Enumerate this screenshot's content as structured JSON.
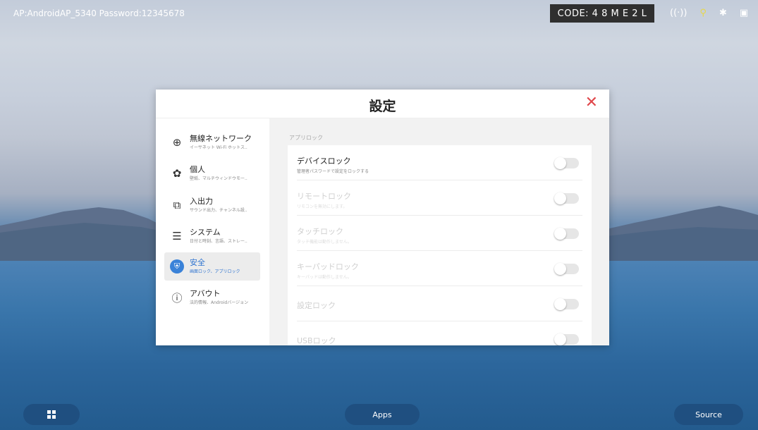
{
  "topbar": {
    "ap_info": "AP:AndroidAP_5340  Password:12345678",
    "code": "CODE: 4 8 M E 2 L",
    "icons": [
      "hotspot-icon",
      "usb-icon",
      "bluetooth-off-icon",
      "screen-icon"
    ]
  },
  "dialog": {
    "title": "設定",
    "close_symbol": "✕"
  },
  "sidebar": {
    "items": [
      {
        "title": "無線ネットワーク",
        "subtitle": "イーサネット Wi-Fi ホットス..",
        "icon": "globe-icon"
      },
      {
        "title": "個人",
        "subtitle": "壁紙、マルチウィンドウモー..",
        "icon": "palette-icon"
      },
      {
        "title": "入出力",
        "subtitle": "サウンド出力、チャンネル設..",
        "icon": "input-output-icon"
      },
      {
        "title": "システム",
        "subtitle": "日付と時刻、言語、ストレー..",
        "icon": "sliders-icon"
      },
      {
        "title": "安全",
        "subtitle": "画面ロック、アプリロック",
        "icon": "shield-icon",
        "active": true
      },
      {
        "title": "アバウト",
        "subtitle": "法的情報、Androidバージョン",
        "icon": "info-icon"
      }
    ]
  },
  "content": {
    "section_label": "アプリロック",
    "rows": [
      {
        "title": "デバイスロック",
        "subtitle": "管理者パスワードで設定をロックする",
        "enabled": true,
        "toggle_on": false
      },
      {
        "title": "リモートロック",
        "subtitle": "リモコンを無効にします。",
        "enabled": false,
        "toggle_on": false
      },
      {
        "title": "タッチロック",
        "subtitle": "タッチ機能は動作しません。",
        "enabled": false,
        "toggle_on": false
      },
      {
        "title": "キーパッドロック",
        "subtitle": "キーパッドは動作しません。",
        "enabled": false,
        "toggle_on": false
      },
      {
        "title": "設定ロック",
        "subtitle": "",
        "enabled": false,
        "toggle_on": false
      },
      {
        "title": "USBロック",
        "subtitle": "",
        "enabled": false,
        "toggle_on": false
      }
    ]
  },
  "taskbar": {
    "start_icon": "windows-icon",
    "apps_label": "Apps",
    "source_label": "Source"
  },
  "colors": {
    "accent": "#3a82d8",
    "close": "#e0484c",
    "taskbar_button": "#1f4f80"
  }
}
